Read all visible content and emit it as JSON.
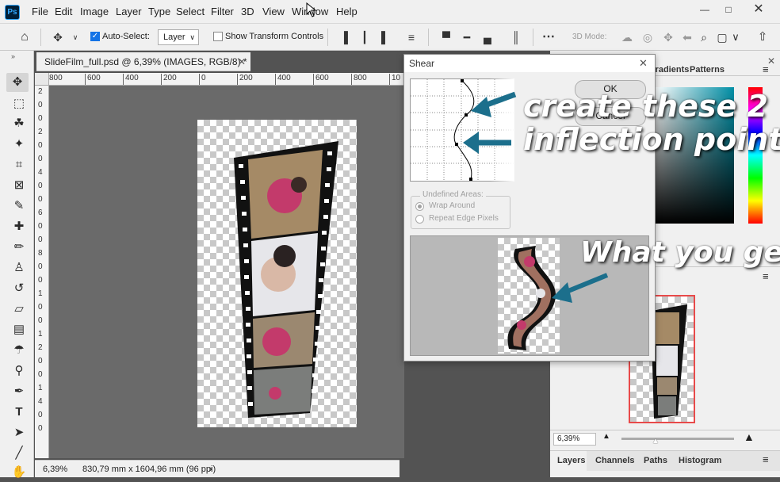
{
  "app": {
    "logo": "Ps"
  },
  "menu": [
    "File",
    "Edit",
    "Image",
    "Layer",
    "Type",
    "Select",
    "Filter",
    "3D",
    "View",
    "Window",
    "Help"
  ],
  "options_bar": {
    "auto_select_label": "Auto-Select:",
    "auto_select_value": "Layer",
    "show_transform_label": "Show Transform Controls",
    "mode_3d_label": "3D Mode:"
  },
  "document": {
    "tab_title": "SlideFilm_full.psd @ 6,39% (IMAGES, RGB/8) *",
    "zoom": "6,39%",
    "dimensions": "830,79 mm x 1604,96 mm (96 ppi)"
  },
  "ruler": {
    "h_ticks": [
      "800",
      "600",
      "400",
      "200",
      "0",
      "200",
      "400",
      "600",
      "800",
      "10"
    ],
    "v_ticks": [
      "2",
      "0",
      "0",
      "2",
      "0",
      "0",
      "4",
      "0",
      "0",
      "6",
      "0",
      "0",
      "8",
      "0",
      "0",
      "1",
      "0",
      "0",
      "1",
      "2",
      "0",
      "0",
      "1",
      "4",
      "0",
      "0"
    ]
  },
  "shear_dialog": {
    "title": "Shear",
    "ok_label": "OK",
    "cancel_label": "Cancel",
    "undefined_areas_label": "Undefined Areas:",
    "wrap_around_label": "Wrap Around",
    "repeat_edge_label": "Repeat Edge Pixels",
    "wrap_around_selected": true
  },
  "right_panel": {
    "top_tabs": [
      "Gradients",
      "Patterns"
    ],
    "nav_zoom": "6,39%",
    "bottom_tabs": [
      "Layers",
      "Channels",
      "Paths",
      "Histogram"
    ]
  },
  "annotations": {
    "line1": "create these 2",
    "line2": "inflection points",
    "result": "What you  get"
  },
  "colors": {
    "accent": "#1c6f8c",
    "nav_frame": "#e84a4a",
    "workspace": "#6a6a6a"
  },
  "icons": [
    "move-icon",
    "marquee-icon",
    "lasso-icon",
    "magic-wand-icon",
    "crop-icon",
    "frame-icon",
    "eyedropper-icon",
    "healing-icon",
    "brush-icon",
    "stamp-icon",
    "history-brush-icon",
    "eraser-icon",
    "gradient-icon",
    "blur-icon",
    "dodge-icon",
    "pen-icon",
    "type-icon",
    "path-select-icon",
    "line-icon",
    "hand-icon"
  ]
}
